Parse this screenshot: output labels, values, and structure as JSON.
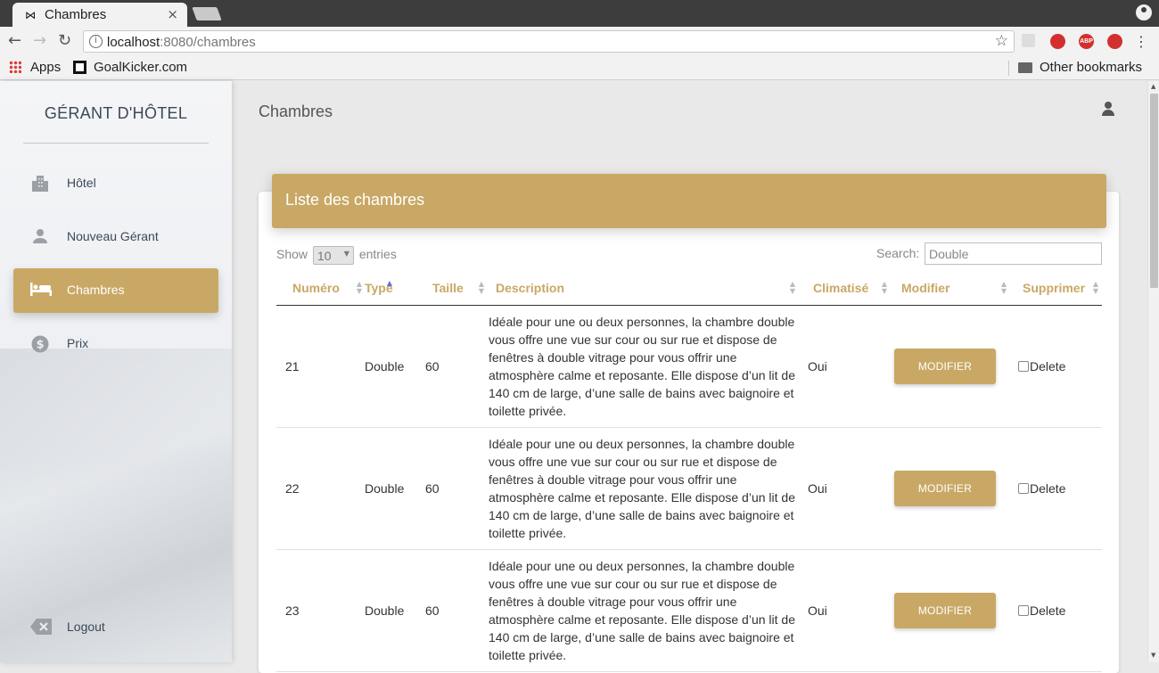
{
  "browser": {
    "tab_title": "Chambres",
    "url_host": "localhost",
    "url_rest": ":8080/chambres",
    "bookmarks": {
      "apps": "Apps",
      "goalkicker": "GoalKicker.com",
      "other": "Other bookmarks"
    },
    "extensions": [
      {
        "name": "readermode-icon",
        "label": "",
        "color": "#bdbdbd"
      },
      {
        "name": "hand-stop-icon",
        "label": "",
        "color": "#d32f2f"
      },
      {
        "name": "adblock-icon",
        "label": "ABP",
        "color": "#d32f2f"
      },
      {
        "name": "delete-ext-icon",
        "label": "",
        "color": "#d32f2f"
      }
    ]
  },
  "sidebar": {
    "brand": "GÉRANT D'HÔTEL",
    "items": [
      {
        "label": "Hôtel",
        "icon": "building-icon"
      },
      {
        "label": "Nouveau Gérant",
        "icon": "person-icon"
      },
      {
        "label": "Chambres",
        "icon": "bed-icon"
      },
      {
        "label": "Prix",
        "icon": "dollar-icon"
      }
    ],
    "logout": "Logout"
  },
  "header": {
    "title": "Chambres"
  },
  "card": {
    "title": "Liste des chambres"
  },
  "datatable": {
    "show_label": "Show",
    "length_value": "10",
    "entries_label": "entries",
    "search_label": "Search:",
    "search_value": "Double",
    "columns": [
      "Numéro",
      "Type",
      "Taille",
      "Description",
      "Climatisé",
      "Modifier",
      "Supprimer"
    ],
    "rows": [
      {
        "numero": "21",
        "type": "Double",
        "taille": "60",
        "description": "Idéale pour une ou deux personnes, la chambre double vous offre une vue sur cour ou sur rue et dispose de fenêtres à double vitrage pour vous offrir une atmosphère calme et reposante. Elle dispose d’un lit de 140 cm de large, d’une salle de bains avec baignoire et toilette privée.",
        "climatise": "Oui",
        "modifier": "MODIFIER",
        "supprimer": "Delete"
      },
      {
        "numero": "22",
        "type": "Double",
        "taille": "60",
        "description": "Idéale pour une ou deux personnes, la chambre double vous offre une vue sur cour ou sur rue et dispose de fenêtres à double vitrage pour vous offrir une atmosphère calme et reposante. Elle dispose d’un lit de 140 cm de large, d’une salle de bains avec baignoire et toilette privée.",
        "climatise": "Oui",
        "modifier": "MODIFIER",
        "supprimer": "Delete"
      },
      {
        "numero": "23",
        "type": "Double",
        "taille": "60",
        "description": "Idéale pour une ou deux personnes, la chambre double vous offre une vue sur cour ou sur rue et dispose de fenêtres à double vitrage pour vous offrir une atmosphère calme et reposante. Elle dispose d’un lit de 140 cm de large, d’une salle de bains avec baignoire et toilette privée.",
        "climatise": "Oui",
        "modifier": "MODIFIER",
        "supprimer": "Delete"
      }
    ]
  },
  "colors": {
    "accent": "#c9a865",
    "sort_active": "#6d6ad6"
  }
}
